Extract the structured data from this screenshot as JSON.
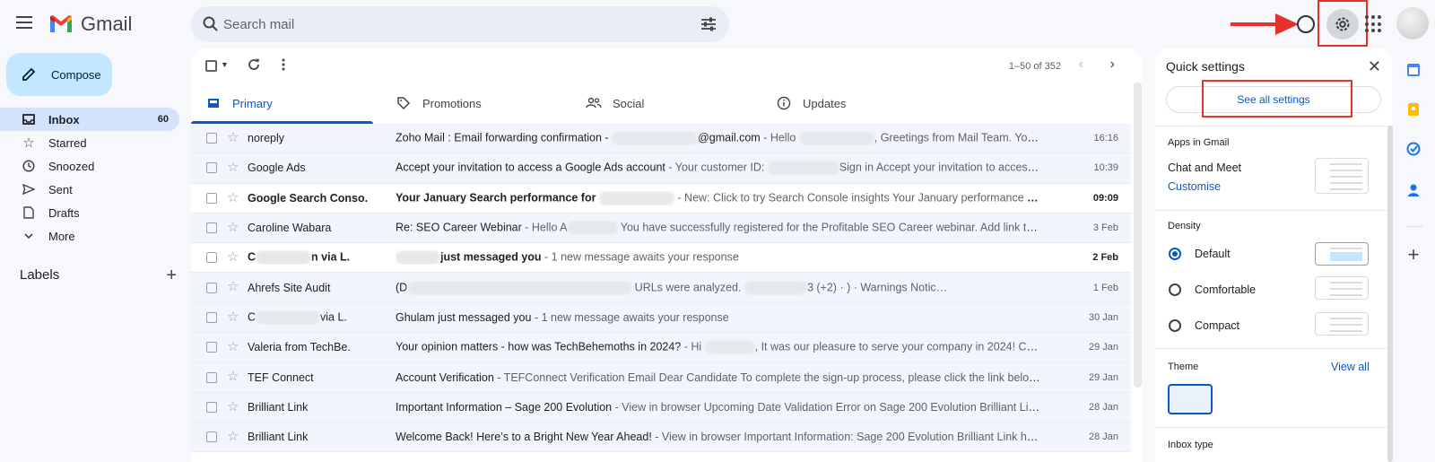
{
  "app": {
    "name": "Gmail"
  },
  "search": {
    "placeholder": "Search mail"
  },
  "sidebar": {
    "compose_label": "Compose",
    "items": [
      {
        "label": "Inbox",
        "count": "60",
        "icon": "inbox-icon",
        "active": true
      },
      {
        "label": "Starred",
        "icon": "star-icon"
      },
      {
        "label": "Snoozed",
        "icon": "clock-icon"
      },
      {
        "label": "Sent",
        "icon": "send-icon"
      },
      {
        "label": "Drafts",
        "icon": "draft-icon"
      },
      {
        "label": "More",
        "icon": "chevron-down-icon"
      }
    ],
    "labels_heading": "Labels",
    "labels_add": "+"
  },
  "toolbar": {
    "pagination": "1–50 of 352"
  },
  "tabs": [
    {
      "label": "Primary",
      "icon": "inbox-icon",
      "active": true
    },
    {
      "label": "Promotions",
      "icon": "tag-icon"
    },
    {
      "label": "Social",
      "icon": "people-icon"
    },
    {
      "label": "Updates",
      "icon": "info-icon"
    }
  ],
  "emails": [
    {
      "sender": "noreply",
      "subject": "Zoho Mail : Email forwarding confirmation - ",
      "subject_tail": "@gmail.com",
      "snippet": " - Hello ",
      "snippet_tail": ", Greetings from Mail Team. You receiv…",
      "date": "16:16",
      "unread": false
    },
    {
      "sender": "Google Ads",
      "subject": "Accept your invitation to access a Google Ads account",
      "subject_tail": "",
      "snippet": " - Your customer ID: ",
      "snippet_tail": "Sign in Accept your invitation to access a Go…",
      "date": "10:39",
      "unread": false
    },
    {
      "sender": "Google Search Conso.",
      "subject": "Your January Search performance for ",
      "subject_tail": "",
      "snippet": " - New: Click to try Search Console insights Your January performance on Goo…",
      "snippet_tail": "",
      "date": "09:09",
      "unread": true
    },
    {
      "sender": "Caroline Wabara",
      "subject": "Re: SEO Career Webinar",
      "subject_tail": "",
      "snippet": " - Hello A",
      "snippet_tail": " You have successfully registered for the Profitable SEO Career webinar. Add link to your Goo…",
      "date": "3 Feb",
      "unread": false
    },
    {
      "sender": "C",
      "sender_tail": "n via L.",
      "subject": "",
      "subject_tail": "just messaged you",
      "snippet": " - 1 new message awaits your response",
      "snippet_tail": "",
      "date": "2 Feb",
      "unread": true
    },
    {
      "sender": "Ahrefs Site Audit",
      "subject": "(D",
      "subject_tail": "",
      "snippet": " URLs were analyzed. ",
      "snippet_tail": "3 (+2) · ) · Warnings Notic…",
      "date": "1 Feb",
      "unread": false
    },
    {
      "sender": "C",
      "sender_tail": "via L.",
      "subject": "Ghulam just messaged you",
      "subject_tail": "",
      "snippet": " - 1 new message awaits your response",
      "snippet_tail": "",
      "date": "30 Jan",
      "unread": false
    },
    {
      "sender": "Valeria from TechBe.",
      "subject": "Your opinion matters - how was TechBehemoths in 2024?",
      "subject_tail": "",
      "snippet": " - Hi ",
      "snippet_tail": ", It was our pleasure to serve your company in 2024! Could you…",
      "date": "29 Jan",
      "unread": false
    },
    {
      "sender": "TEF Connect",
      "subject": "Account Verification",
      "subject_tail": "",
      "snippet": " - TEFConnect Verification Email Dear Candidate To complete the sign-up process, please click the link below to ver…",
      "snippet_tail": "",
      "date": "29 Jan",
      "unread": false
    },
    {
      "sender": "Brilliant Link",
      "subject": "Important Information – Sage 200 Evolution",
      "subject_tail": "",
      "snippet": " - View in browser Upcoming Date Validation Error on Sage 200 Evolution Brilliant Link has b…",
      "snippet_tail": "",
      "date": "28 Jan",
      "unread": false
    },
    {
      "sender": "Brilliant Link",
      "subject": "Welcome Back! Here’s to a Bright New Year Ahead!",
      "subject_tail": "",
      "snippet": " - View in browser Important Information: Sage 200 Evolution Brilliant Link has been n…",
      "snippet_tail": "",
      "date": "28 Jan",
      "unread": false
    }
  ],
  "quick_settings": {
    "title": "Quick settings",
    "see_all": "See all settings",
    "apps_heading": "Apps in Gmail",
    "apps_value": "Chat and Meet",
    "customise": "Customise",
    "density_heading": "Density",
    "density_options": [
      {
        "label": "Default",
        "checked": true
      },
      {
        "label": "Comfortable",
        "checked": false
      },
      {
        "label": "Compact",
        "checked": false
      }
    ],
    "theme_heading": "Theme",
    "theme_view_all": "View all",
    "inbox_type_heading": "Inbox type"
  },
  "colors": {
    "accent": "#0b57d0",
    "highlight": "#e5322d",
    "compose": "#c2e7ff",
    "active_nav": "#d3e3fd"
  }
}
